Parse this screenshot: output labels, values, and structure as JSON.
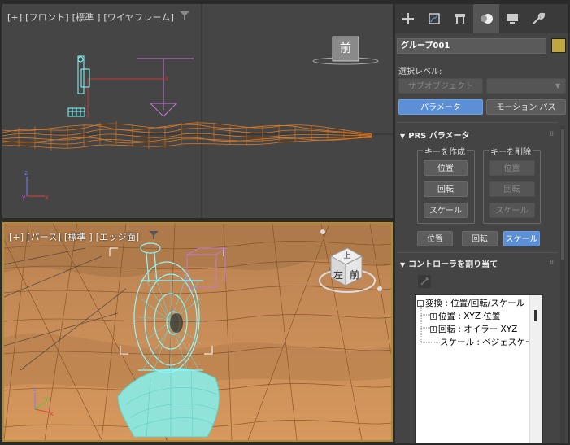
{
  "viewport_top": {
    "label": "[+] [フロント] [標準 ] [ワイヤフレーム]",
    "viewcube_face": "前"
  },
  "viewport_bottom": {
    "label": "[+] [パース] [標準 ] [エッジ面]",
    "viewcube_top": "上",
    "viewcube_front": "前",
    "viewcube_left": "左"
  },
  "command_panel": {
    "tabs": [
      "create-icon",
      "modify-icon",
      "hierarchy-icon",
      "motion-icon",
      "display-icon",
      "utilities-icon"
    ],
    "active_tab": "motion-icon",
    "object_name": "グループ001",
    "object_color": "#bfa63e",
    "selection_level_label": "選択レベル:",
    "subobject_button": "サブオブジェクト",
    "parameters_button": "パラメータ",
    "motion_paths_button": "モーション パス",
    "prs_rollout": {
      "title": "PRS パラメータ",
      "create_key_title": "キーを作成",
      "delete_key_title": "キーを削除",
      "create_position": "位置",
      "create_rotation": "回転",
      "create_scale": "スケール",
      "delete_position": "位置",
      "delete_rotation": "回転",
      "delete_scale": "スケール",
      "tab_position": "位置",
      "tab_rotation": "回転",
      "tab_scale": "スケール"
    },
    "assign_rollout": {
      "title": "コントローラを割り当て",
      "tree": [
        "変換 : 位置/回転/スケール",
        "位置 : XYZ 位置",
        "回転 : オイラー XYZ",
        "スケール : ベジェスケール"
      ]
    }
  },
  "colors": {
    "accent_blue": "#5b8fd6",
    "selection_cyan": "#7fffff",
    "terrain_orange": "#c98d55",
    "wire_orange": "#e07a1f"
  }
}
